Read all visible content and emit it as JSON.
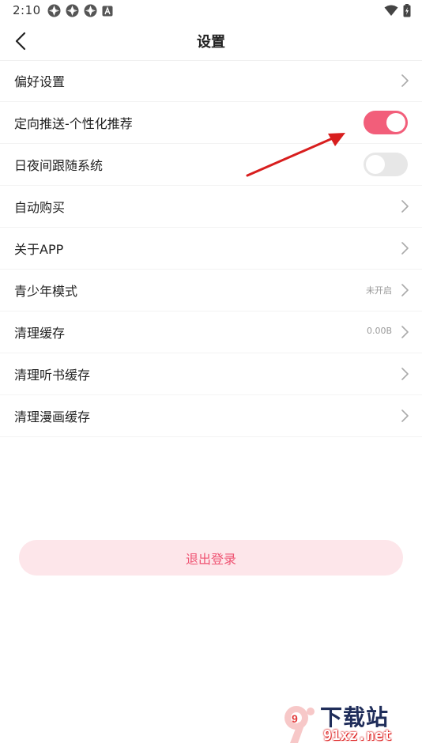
{
  "status_bar": {
    "time": "2:10",
    "left_icons": [
      "app-notification-icon",
      "app-notification-icon",
      "app-notification-icon",
      "font-a-icon"
    ],
    "right_icons": [
      "wifi-icon",
      "battery-charging-icon"
    ]
  },
  "header": {
    "title": "设置",
    "back_icon": "chevron-left-icon"
  },
  "settings": {
    "rows": [
      {
        "label": "偏好设置",
        "type": "link"
      },
      {
        "label": "定向推送-个性化推荐",
        "type": "toggle",
        "on": true
      },
      {
        "label": "日夜间跟随系统",
        "type": "toggle",
        "on": false
      },
      {
        "label": "自动购买",
        "type": "link"
      },
      {
        "label": "关于APP",
        "type": "link"
      },
      {
        "label": "青少年模式",
        "type": "link",
        "value": "未开启"
      },
      {
        "label": "清理缓存",
        "type": "link",
        "value": "0.00B"
      },
      {
        "label": "清理听书缓存",
        "type": "link"
      },
      {
        "label": "清理漫画缓存",
        "type": "link"
      }
    ]
  },
  "logout": {
    "label": "退出登录"
  },
  "colors": {
    "accent": "#f25e7a",
    "logout_bg": "#fde6ea",
    "logout_text": "#ef5473",
    "annotation_arrow": "#d81e1e"
  },
  "watermark": {
    "logo": "9",
    "title": "下载站",
    "url": "91xz.net"
  }
}
